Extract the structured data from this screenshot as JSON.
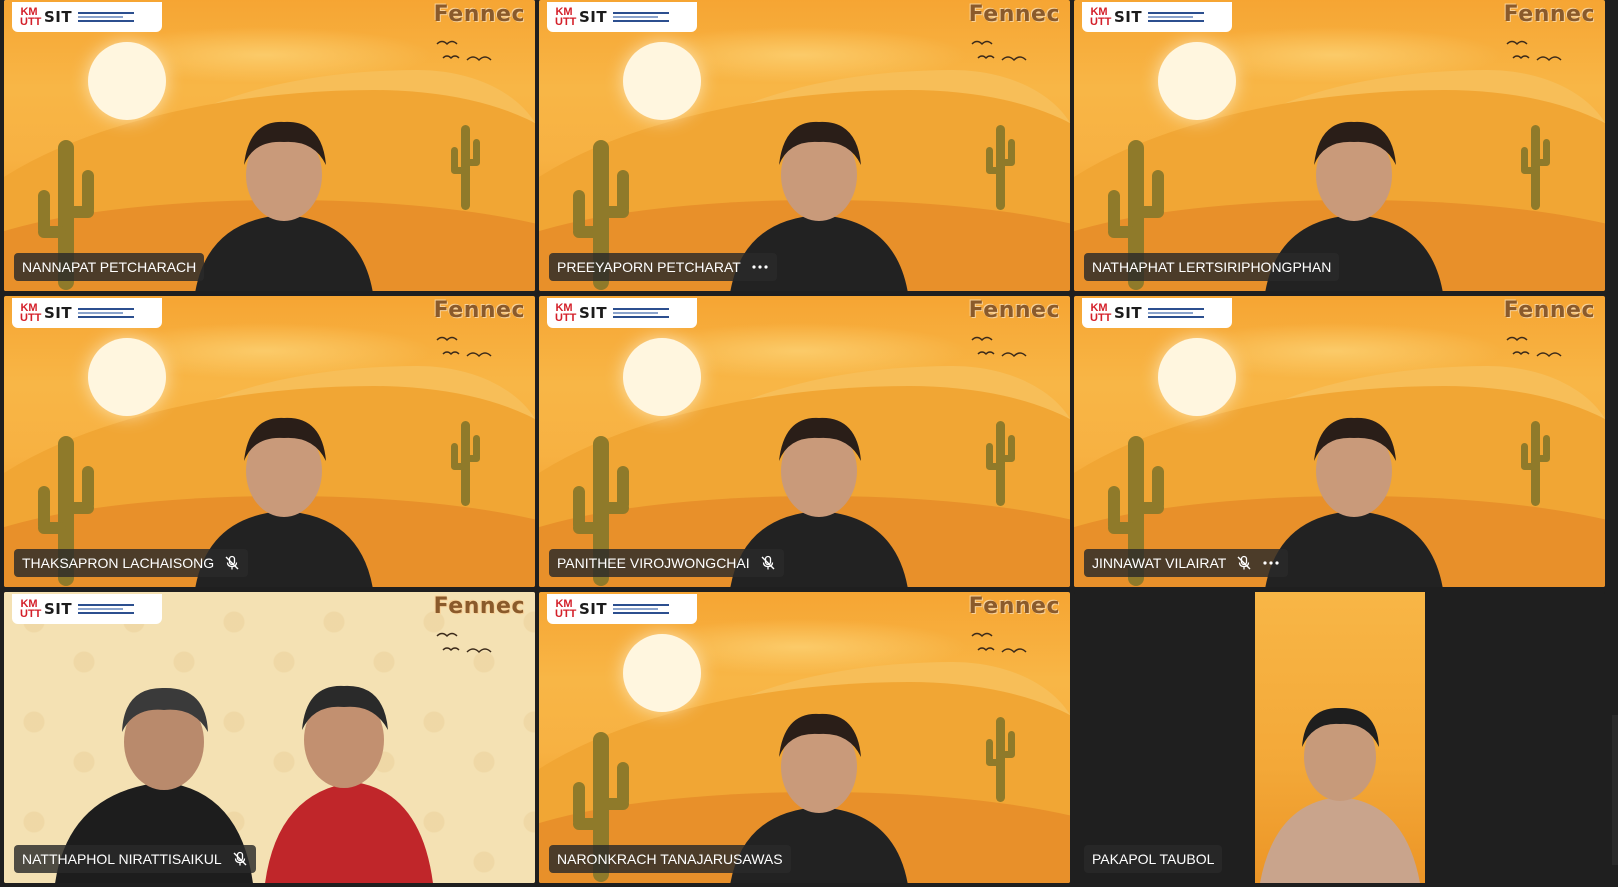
{
  "participants": [
    {
      "name": "NANNAPAT PETCHARACH",
      "muted": false,
      "more": false,
      "active": true,
      "background": "desert"
    },
    {
      "name": "PREEYAPORN PETCHARAT",
      "muted": false,
      "more": true,
      "active": false,
      "background": "desert"
    },
    {
      "name": "NATHAPHAT LERTSIRIPHONGPHAN",
      "muted": false,
      "more": false,
      "active": false,
      "background": "desert"
    },
    {
      "name": "THAKSAPRON LACHAISONG",
      "muted": true,
      "more": false,
      "active": false,
      "background": "desert"
    },
    {
      "name": "PANITHEE VIROJWONGCHAI",
      "muted": true,
      "more": false,
      "active": false,
      "background": "desert"
    },
    {
      "name": "JINNAWAT VILAIRAT",
      "muted": true,
      "more": true,
      "active": false,
      "background": "desert"
    },
    {
      "name": "NATTHAPHOL NIRATTISAIKUL",
      "muted": true,
      "more": false,
      "active": false,
      "background": "pattern"
    },
    {
      "name": "NARONKRACH TANAJARUSAWAS",
      "muted": false,
      "more": false,
      "active": false,
      "background": "desert"
    },
    {
      "name": "PAKAPOL TAUBOL",
      "muted": false,
      "more": false,
      "active": false,
      "background": "portrait"
    }
  ],
  "branding": {
    "logo_left": "SIT",
    "logo_kmutt": "KM UTT",
    "wordmark": "Fennec"
  },
  "colors": {
    "active_border": "#7b83eb",
    "nameplate_bg": "#292929",
    "app_bg": "#1f1f1f"
  },
  "icons": {
    "mic_off": "mic-off-icon",
    "more": "more-options-icon"
  }
}
